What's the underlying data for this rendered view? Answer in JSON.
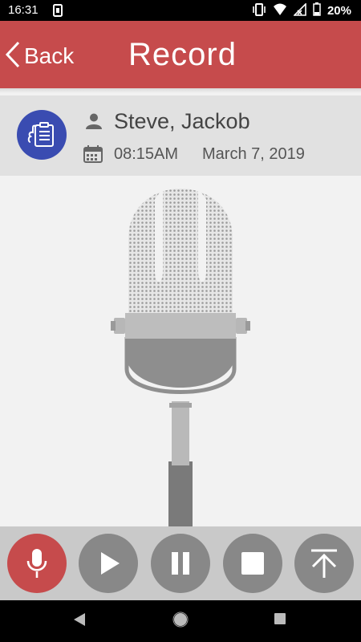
{
  "status_bar": {
    "time": "16:31",
    "battery": "20%"
  },
  "header": {
    "back_label": "Back",
    "title": "Record"
  },
  "appointment": {
    "name": "Steve, Jackob",
    "time": "08:15AM",
    "date": "March 7, 2019"
  },
  "colors": {
    "accent": "#c64b4c",
    "avatar": "#3a4cb1",
    "control": "#888888"
  },
  "controls": [
    "microphone-icon",
    "play-icon",
    "pause-icon",
    "stop-icon",
    "upload-icon"
  ],
  "nav": [
    "back-triangle-icon",
    "home-circle-icon",
    "recents-square-icon"
  ]
}
